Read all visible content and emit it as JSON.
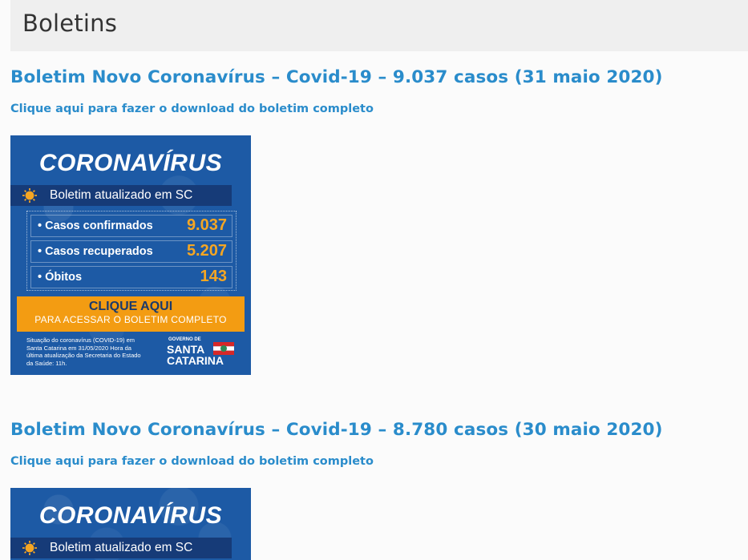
{
  "page": {
    "title": "Boletins"
  },
  "posts": [
    {
      "title": "Boletim Novo Coronavírus – Covid-19 – 9.037 casos (31 maio 2020)",
      "download_link": "Clique aqui para fazer o download do boletim completo",
      "banner": {
        "headline": "CORONAVÍRUS",
        "strip_text": "Boletim atualizado em SC",
        "stats": [
          {
            "label": "• Casos confirmados",
            "value": "9.037"
          },
          {
            "label": "• Casos recuperados",
            "value": "5.207"
          },
          {
            "label": "• Óbitos",
            "value": "143"
          }
        ],
        "cta_main": "CLIQUE AQUI",
        "cta_sub": "PARA ACESSAR O BOLETIM COMPLETO",
        "footnote": "Situação do coronavírus (COVID-19) em Santa Catarina em 31/05/2020 Hora da última atualização da Secretaria do Estado da Saúde: 11h.",
        "gov_small": "GOVERNO DE",
        "gov_line1": "SANTA",
        "gov_line2": "CATARINA"
      }
    },
    {
      "title": "Boletim Novo Coronavírus – Covid-19 – 8.780 casos (30 maio 2020)",
      "download_link": "Clique aqui para fazer o download do boletim completo",
      "banner": {
        "headline": "CORONAVÍRUS",
        "strip_text": "Boletim atualizado em SC"
      }
    }
  ],
  "colors": {
    "link": "#2a8ccb",
    "banner_blue": "#1d5aa5",
    "strip_navy": "#163b78",
    "accent_orange": "#f39c12",
    "stat_orange": "#f5a623"
  },
  "icons": {
    "virus": "virus-icon",
    "flag": "sc-flag-icon"
  }
}
